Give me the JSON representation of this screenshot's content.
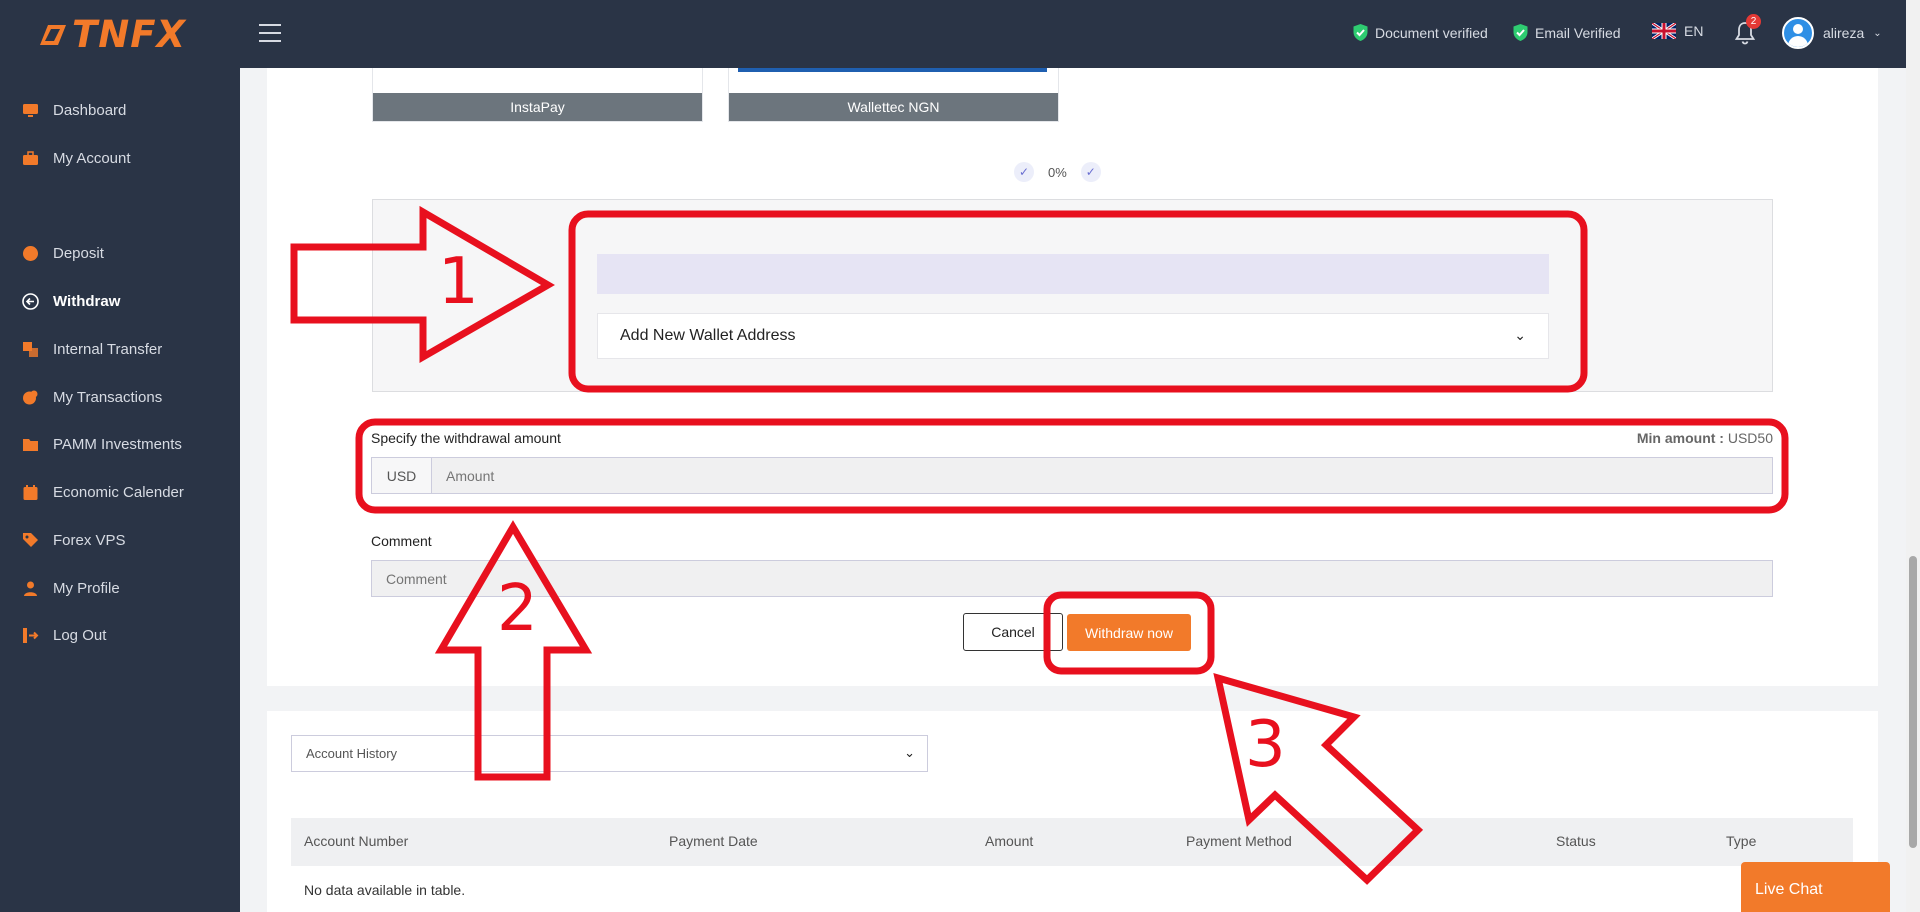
{
  "brand": {
    "logo_text": "TNFX"
  },
  "header": {
    "document_status": "Document verified",
    "email_status": "Email Verified",
    "language": "EN",
    "notification_count": "2",
    "username": "alireza"
  },
  "sidebar": {
    "items": [
      {
        "label": "Dashboard",
        "icon": "monitor-icon"
      },
      {
        "label": "My Account",
        "icon": "briefcase-icon"
      },
      {
        "label": "Deposit",
        "icon": "circle-icon"
      },
      {
        "label": "Withdraw",
        "icon": "arrow-left-circle-icon",
        "active": true
      },
      {
        "label": "Internal Transfer",
        "icon": "transfer-icon"
      },
      {
        "label": "My Transactions",
        "icon": "coins-icon"
      },
      {
        "label": "PAMM Investments",
        "icon": "folder-icon"
      },
      {
        "label": "Economic Calender",
        "icon": "calendar-icon"
      },
      {
        "label": "Forex VPS",
        "icon": "tag-icon"
      },
      {
        "label": "My Profile",
        "icon": "user-icon"
      },
      {
        "label": "Log Out",
        "icon": "logout-icon"
      }
    ]
  },
  "payment_methods": [
    {
      "label": "InstaPay"
    },
    {
      "label": "Wallettec NGN"
    }
  ],
  "progress": {
    "fee": "0%"
  },
  "wallet": {
    "select_label": "Add New Wallet Address"
  },
  "amount": {
    "label": "Specify the withdrawal amount",
    "min_label": "Min amount :",
    "min_value": "USD50",
    "currency": "USD",
    "placeholder": "Amount"
  },
  "comment": {
    "label": "Comment",
    "placeholder": "Comment"
  },
  "buttons": {
    "cancel": "Cancel",
    "withdraw": "Withdraw now"
  },
  "history": {
    "select_label": "Account History",
    "columns": [
      "Account Number",
      "Payment Date",
      "Amount",
      "Payment Method",
      "Status",
      "Type"
    ],
    "empty_text": "No data available in table."
  },
  "live_chat": "Live Chat",
  "annotations": {
    "step1": "1",
    "step2": "2",
    "step3": "3"
  },
  "colors": {
    "sidebar_bg": "#2a3446",
    "accent": "#f27a2a",
    "annotation_red": "#e8101e",
    "verified_green": "#2ecc71"
  }
}
